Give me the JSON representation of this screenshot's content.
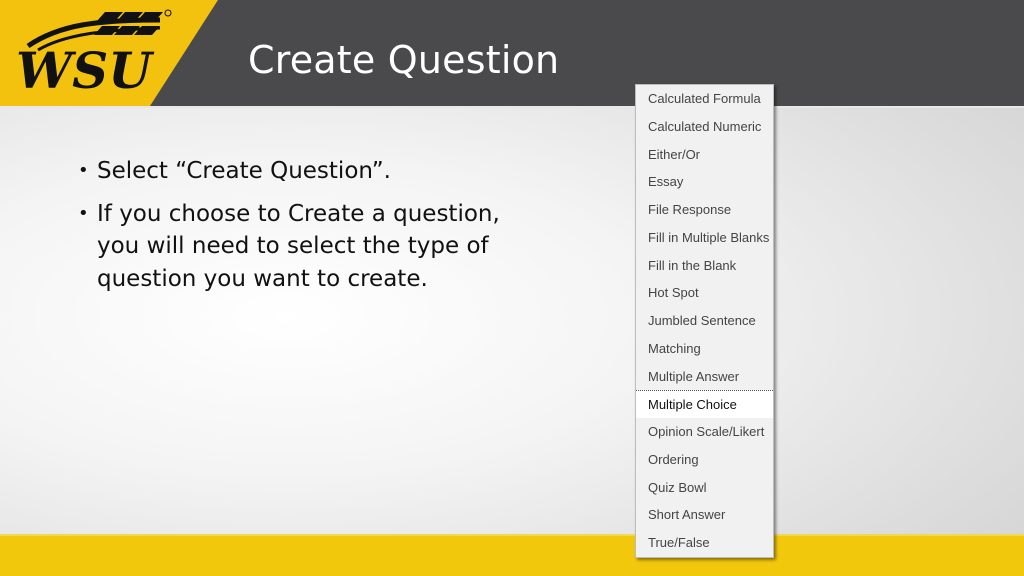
{
  "header": {
    "logo_text": "WSU",
    "title": "Create Question"
  },
  "bullets": [
    "Select “Create Question”.",
    "If you choose to Create a question, you will need to select the type of question you want to create."
  ],
  "question_type_menu": {
    "selected": "Multiple Choice",
    "items": [
      "Calculated Formula",
      "Calculated Numeric",
      "Either/Or",
      "Essay",
      "File Response",
      "Fill in Multiple Blanks",
      "Fill in the Blank",
      "Hot Spot",
      "Jumbled Sentence",
      "Matching",
      "Multiple Answer",
      "Multiple Choice",
      "Opinion Scale/Likert",
      "Ordering",
      "Quiz Bowl",
      "Short Answer",
      "True/False"
    ]
  },
  "colors": {
    "brand_yellow": "#f2c20f",
    "header_gray": "#4a4a4c"
  }
}
